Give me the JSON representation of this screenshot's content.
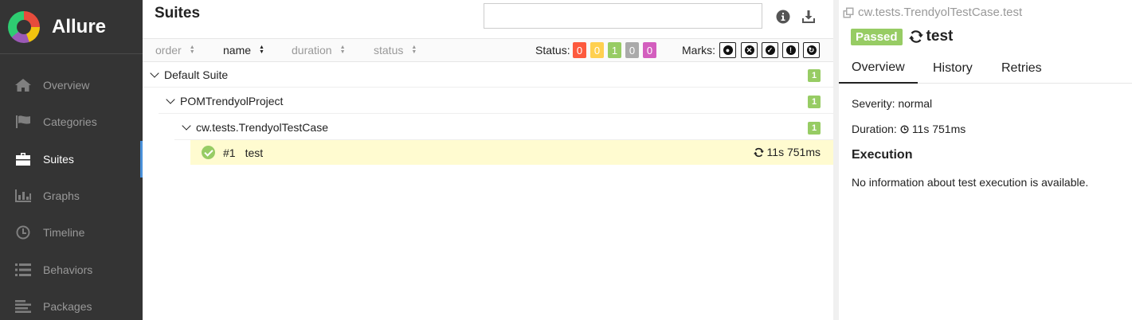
{
  "sidebar": {
    "brand": "Allure",
    "items": [
      {
        "label": "Overview",
        "icon": "home-icon"
      },
      {
        "label": "Categories",
        "icon": "flag-icon"
      },
      {
        "label": "Suites",
        "icon": "briefcase-icon",
        "active": true
      },
      {
        "label": "Graphs",
        "icon": "bar-chart-icon"
      },
      {
        "label": "Timeline",
        "icon": "clock-icon"
      },
      {
        "label": "Behaviors",
        "icon": "list-icon"
      },
      {
        "label": "Packages",
        "icon": "align-left-icon"
      }
    ]
  },
  "main": {
    "title": "Suites",
    "search_value": "",
    "tools": [
      "info-icon",
      "download-icon"
    ],
    "sort": [
      "order",
      "name",
      "duration",
      "status"
    ],
    "active_sort": "name",
    "status_label": "Status:",
    "status_counts": [
      {
        "value": "0",
        "color": "#fd5a3e",
        "meaning": "failed"
      },
      {
        "value": "0",
        "color": "#ffd050",
        "meaning": "broken"
      },
      {
        "value": "1",
        "color": "#97cc64",
        "meaning": "passed"
      },
      {
        "value": "0",
        "color": "#aaaaaa",
        "meaning": "skipped"
      },
      {
        "value": "0",
        "color": "#d35ebe",
        "meaning": "unknown"
      }
    ],
    "marks_label": "Marks:",
    "marks": [
      "flaky-icon",
      "new-failed-icon",
      "new-passed-icon",
      "new-broken-icon",
      "retries-status-change-icon"
    ],
    "tree": [
      {
        "label": "Default Suite",
        "count": "1"
      },
      {
        "label": "POMTrendyolProject",
        "count": "1"
      },
      {
        "label": "cw.tests.TrendyolTestCase",
        "count": "1"
      }
    ],
    "test": {
      "number": "#1",
      "name": "test",
      "duration": "11s 751ms"
    }
  },
  "detail": {
    "breadcrumb": "cw.tests.TrendyolTestCase.test",
    "status": "Passed",
    "title": "test",
    "tabs": [
      "Overview",
      "History",
      "Retries"
    ],
    "severity": "Severity: normal",
    "duration_label": "Duration:",
    "duration_value": "11s 751ms",
    "execution_title": "Execution",
    "execution_text": "No information about test execution is available."
  },
  "colors": {
    "passed": "#97cc64",
    "sidebar_bg": "#343434",
    "active_indicator": "#4a90d9",
    "selected_row": "#fffbd0"
  }
}
